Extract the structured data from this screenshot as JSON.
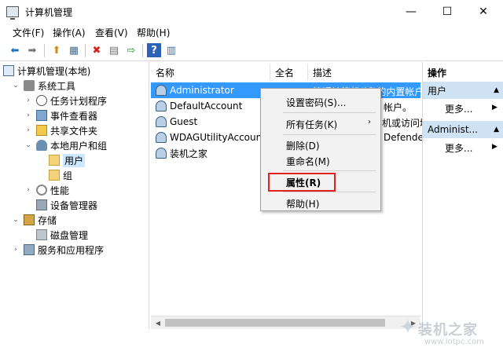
{
  "window": {
    "title": "计算机管理",
    "controls": {
      "minimize": "—",
      "maximize": "☐",
      "close": "✕"
    }
  },
  "menu": [
    "文件(F)",
    "操作(A)",
    "查看(V)",
    "帮助(H)"
  ],
  "toolbar": {
    "icons": [
      "back-arrow-icon",
      "forward-arrow-icon",
      "up-folder-icon",
      "show-hide-tree-icon",
      "delete-icon",
      "properties-icon",
      "export-list-icon",
      "help-icon",
      "show-hide-action-pane-icon"
    ],
    "glyphs": {
      "back": "⬅",
      "forward": "➡",
      "up": "⬆",
      "tree": "▦",
      "delete": "✖",
      "properties": "▤",
      "export": "⇨",
      "help": "?",
      "pane": "▥"
    }
  },
  "tree": [
    {
      "label": "计算机管理(本地)",
      "icon": "computer-icon",
      "level": 0,
      "chevron": ""
    },
    {
      "label": "系统工具",
      "icon": "tools-icon",
      "level": 1,
      "chevron": "⌄"
    },
    {
      "label": "任务计划程序",
      "icon": "clock-icon",
      "level": 2,
      "chevron": "›"
    },
    {
      "label": "事件查看器",
      "icon": "event-viewer-icon",
      "level": 2,
      "chevron": "›"
    },
    {
      "label": "共享文件夹",
      "icon": "shared-folder-icon",
      "level": 2,
      "chevron": "›"
    },
    {
      "label": "本地用户和组",
      "icon": "users-icon",
      "level": 2,
      "chevron": "⌄"
    },
    {
      "label": "用户",
      "icon": "folder-icon",
      "level": 3,
      "chevron": "",
      "selected": true
    },
    {
      "label": "组",
      "icon": "folder-icon",
      "level": 3,
      "chevron": ""
    },
    {
      "label": "性能",
      "icon": "performance-icon",
      "level": 2,
      "chevron": "›"
    },
    {
      "label": "设备管理器",
      "icon": "device-manager-icon",
      "level": 2,
      "chevron": ""
    },
    {
      "label": "存储",
      "icon": "storage-icon",
      "level": 1,
      "chevron": "⌄"
    },
    {
      "label": "磁盘管理",
      "icon": "disk-icon",
      "level": 2,
      "chevron": ""
    },
    {
      "label": "服务和应用程序",
      "icon": "services-icon",
      "level": 1,
      "chevron": "›"
    }
  ],
  "list": {
    "columns": [
      "名称",
      "全名",
      "描述"
    ],
    "rows": [
      {
        "name": "Administrator",
        "description": "管理计算机(域)的内置帐户",
        "selected": true
      },
      {
        "name": "DefaultAccount",
        "description": "帐户。"
      },
      {
        "name": "Guest",
        "description": "机或访问域"
      },
      {
        "name": "WDAGUtilityAccount",
        "description": "Defende"
      },
      {
        "name": "装机之家",
        "description": ""
      }
    ]
  },
  "context_menu": {
    "items": [
      {
        "label": "设置密码(S)...",
        "submenu": false
      },
      {
        "label": "所有任务(K)",
        "submenu": true
      },
      {
        "label": "删除(D)",
        "submenu": false
      },
      {
        "label": "重命名(M)",
        "submenu": false
      },
      {
        "label": "属性(R)",
        "submenu": false,
        "bold": true,
        "highlighted": true
      },
      {
        "label": "帮助(H)",
        "submenu": false
      }
    ],
    "submenu_arrow": "›",
    "highlight_color": "#e0201c"
  },
  "actions": {
    "header": "操作",
    "sections": [
      {
        "title": "用户",
        "more": "更多..."
      },
      {
        "title": "Administ...",
        "more": "更多..."
      }
    ],
    "collapse_glyph": "▲",
    "more_arrow": "▶"
  },
  "watermark": {
    "text": "装机之家",
    "sub": "www.lotpc.com"
  },
  "colors": {
    "selection": "#3399ff",
    "tree_selection": "#cce8ff",
    "action_section": "#cfe3f5",
    "highlight_box": "#e0201c"
  }
}
